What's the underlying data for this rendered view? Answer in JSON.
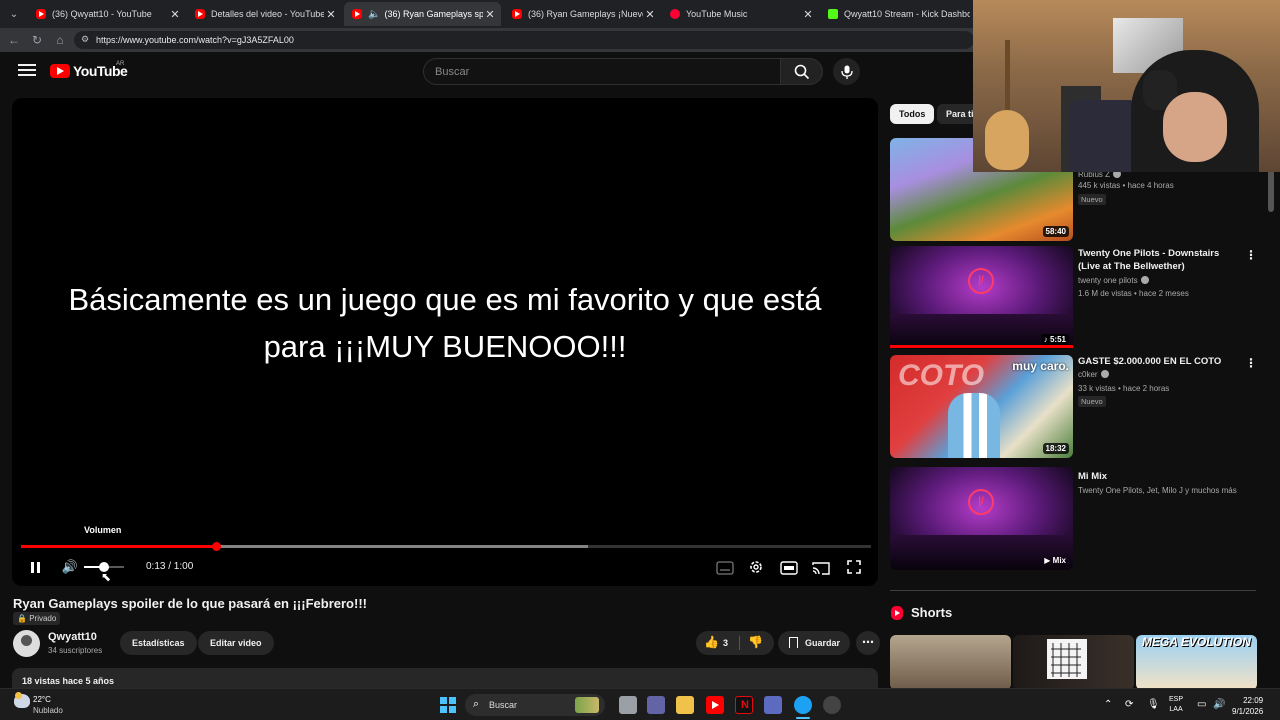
{
  "browser": {
    "tabs": [
      {
        "title": "(36) Qwyatt10 - YouTube",
        "favicon": "youtube-icon"
      },
      {
        "title": "Detalles del video - YouTube Studio",
        "favicon": "youtube-studio-icon"
      },
      {
        "title": "(36) Ryan Gameplays spoiler de",
        "favicon": "youtube-icon",
        "active": true
      },
      {
        "title": "(36) Ryan Gameplays ¡Nuevo Sec",
        "favicon": "youtube-icon"
      },
      {
        "title": "YouTube Music",
        "favicon": "youtube-music-icon"
      },
      {
        "title": "Qwyatt10 Stream - Kick Dashboard",
        "favicon": "kick-icon"
      }
    ],
    "url": "https://www.youtube.com/watch?v=gJ3A5ZFAL00"
  },
  "header": {
    "logo_text": "YouTube",
    "country": "AR",
    "search_placeholder": "Buscar"
  },
  "player": {
    "caption_line1": "Básicamente es un juego que es mi favorito y que está",
    "caption_line2": "para ¡¡¡MUY BUENOOO!!!",
    "volume_tooltip": "Volumen",
    "time": "0:13 / 1:00",
    "progress_played": 0.229,
    "progress_loaded": 0.667,
    "volume_level": 0.5
  },
  "video": {
    "title": "Ryan Gameplays spoiler de lo que pasará en ¡¡¡Febrero!!!",
    "privacy": "Privado",
    "channel": "Qwyatt10",
    "subscribers": "34 suscriptores",
    "stats_button": "Estadísticas",
    "edit_button": "Editar video",
    "likes": "3",
    "save_button": "Guardar",
    "views_meta": "18 vistas  hace 5 años"
  },
  "sidebar": {
    "chips": [
      "Todos",
      "Para ti"
    ],
    "related": [
      {
        "channel_partial": "Rubius Z",
        "meta": "445 k vistas • hace 4 horas",
        "badge": "Nuevo",
        "duration": "58:40"
      },
      {
        "title": "Twenty One Pilots - Downstairs (Live at The Bellwether)",
        "channel": "twenty one pilots",
        "meta": "1.6 M de vistas • hace 2 meses",
        "duration": "5:51"
      },
      {
        "title": "GASTE $2.000.000 EN EL COTO",
        "channel": "c0ker",
        "meta": "33 k vistas • hace 2 horas",
        "badge": "Nuevo",
        "duration": "18:32",
        "thumb_text": "COTO",
        "thumb_overlay": "muy caro."
      },
      {
        "title": "Mi Mix",
        "channel": "Twenty One Pilots, Jet, Milo J y muchos más",
        "badge": "Mix"
      }
    ],
    "shorts_title": "Shorts",
    "short3_text": "MEGA EVOLUTION"
  },
  "taskbar": {
    "temp": "22°C",
    "weather": "Nublado",
    "search": "Buscar",
    "lang1": "ESP",
    "lang2": "LAA",
    "time": "22:09",
    "date": "9/1/2026"
  }
}
